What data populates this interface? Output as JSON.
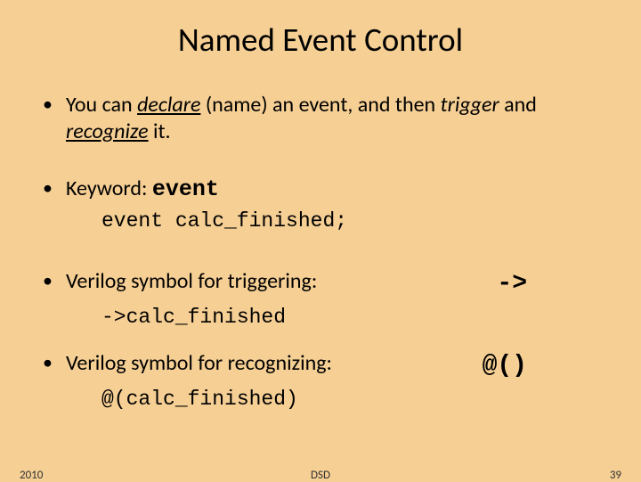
{
  "title": "Named Event Control",
  "bullet1": {
    "pre": "You can ",
    "declare": "declare",
    "mid1": " (name) an event, and then ",
    "trigger": "trigger",
    "mid2": " and ",
    "recognize": "recognize",
    "post": " it."
  },
  "bullet2": {
    "label": "Keyword: ",
    "keyword": "event",
    "code": "event calc_finished;"
  },
  "bullet3": {
    "label": "Verilog symbol for triggering:",
    "symbol": "->",
    "code": "->calc_finished"
  },
  "bullet4": {
    "label": "Verilog symbol for recognizing:",
    "symbol": "@()",
    "code": "@(calc_finished)"
  },
  "footer": {
    "left": "2010",
    "center": "DSD",
    "right": "39"
  }
}
